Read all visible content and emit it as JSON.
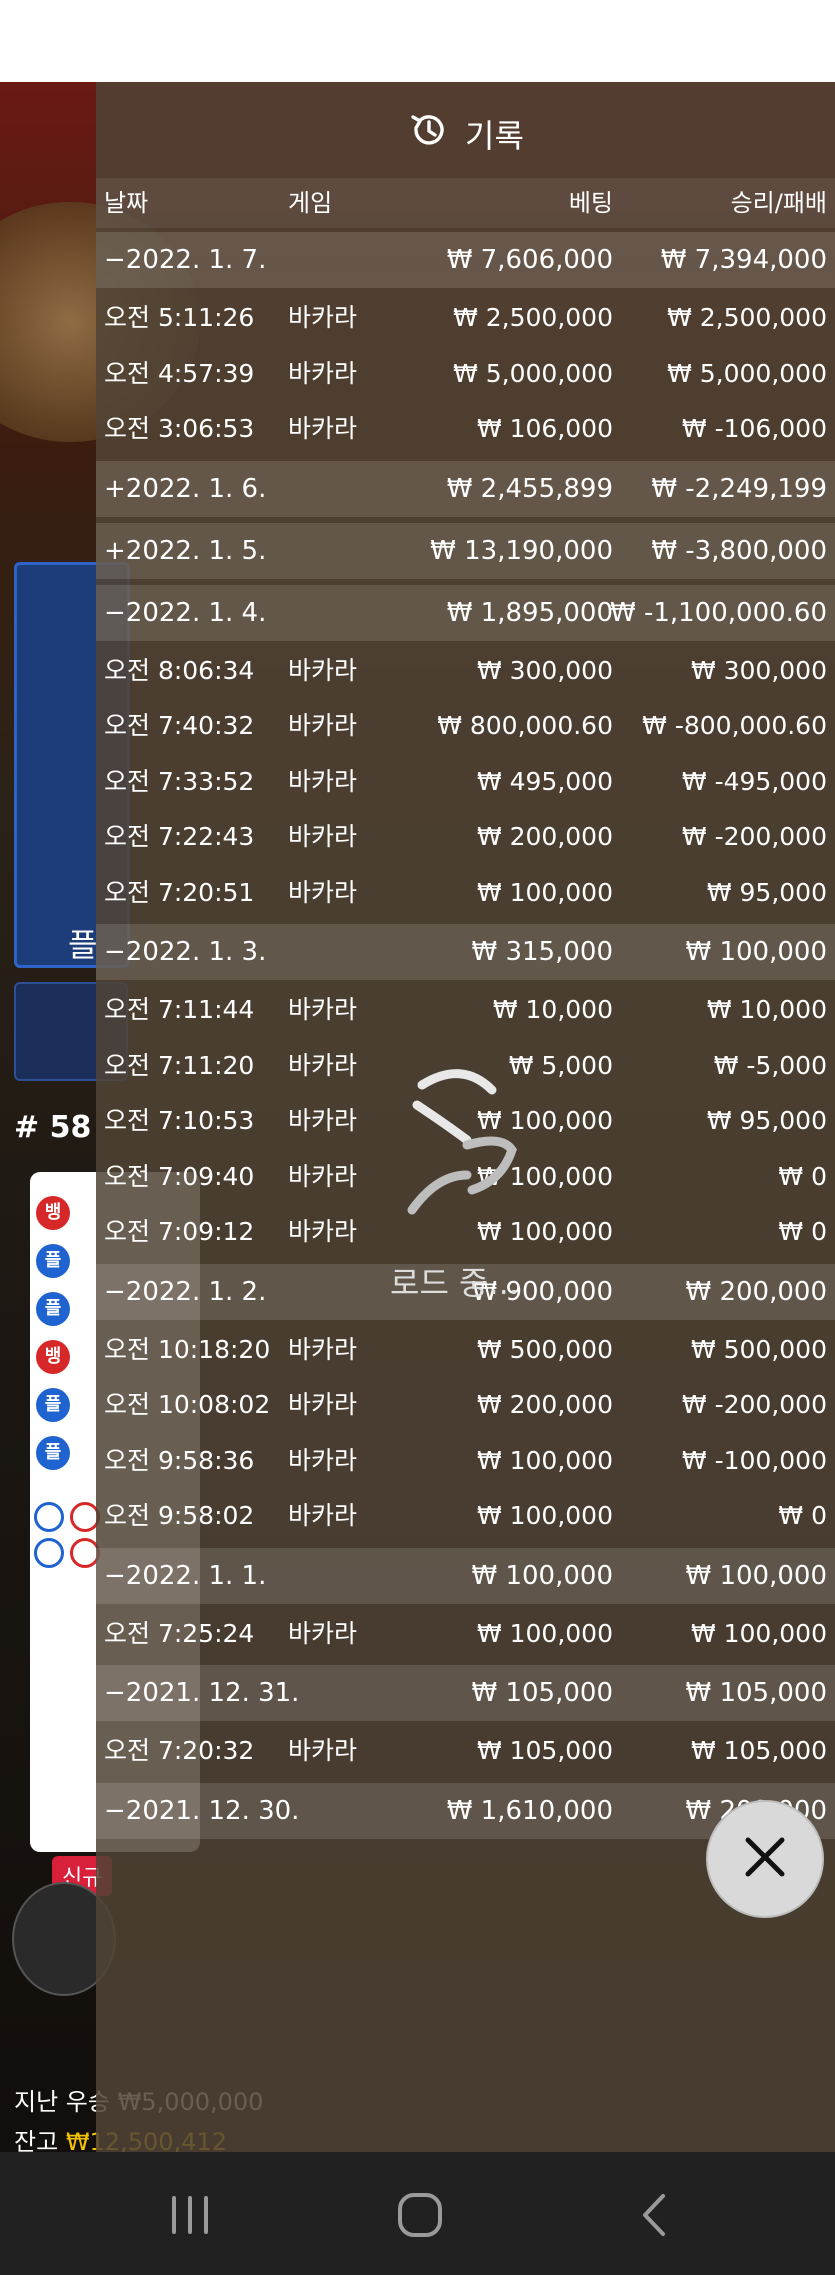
{
  "panel": {
    "title": "기록",
    "columns": {
      "date": "날짜",
      "game": "게임",
      "bet": "베팅",
      "result": "승리/패배"
    }
  },
  "rows": [
    {
      "type": "group",
      "date": "−2022. 1. 7.",
      "game": "",
      "bet": "₩ 7,606,000",
      "result": "₩ 7,394,000"
    },
    {
      "type": "item",
      "date": "오전 5:11:26",
      "game": "바카라",
      "bet": "₩ 2,500,000",
      "result": "₩ 2,500,000"
    },
    {
      "type": "item",
      "date": "오전 4:57:39",
      "game": "바카라",
      "bet": "₩ 5,000,000",
      "result": "₩ 5,000,000"
    },
    {
      "type": "item",
      "date": "오전 3:06:53",
      "game": "바카라",
      "bet": "₩ 106,000",
      "result": "₩ -106,000"
    },
    {
      "type": "group",
      "date": "+2022. 1. 6.",
      "game": "",
      "bet": "₩ 2,455,899",
      "result": "₩ -2,249,199"
    },
    {
      "type": "group",
      "date": "+2022. 1. 5.",
      "game": "",
      "bet": "₩ 13,190,000",
      "result": "₩ -3,800,000"
    },
    {
      "type": "group",
      "date": "−2022. 1. 4.",
      "game": "",
      "bet": "₩ 1,895,000",
      "result": "₩ -1,100,000.60"
    },
    {
      "type": "item",
      "date": "오전 8:06:34",
      "game": "바카라",
      "bet": "₩ 300,000",
      "result": "₩ 300,000"
    },
    {
      "type": "item",
      "date": "오전 7:40:32",
      "game": "바카라",
      "bet": "₩ 800,000.60",
      "result": "₩ -800,000.60"
    },
    {
      "type": "item",
      "date": "오전 7:33:52",
      "game": "바카라",
      "bet": "₩ 495,000",
      "result": "₩ -495,000"
    },
    {
      "type": "item",
      "date": "오전 7:22:43",
      "game": "바카라",
      "bet": "₩ 200,000",
      "result": "₩ -200,000"
    },
    {
      "type": "item",
      "date": "오전 7:20:51",
      "game": "바카라",
      "bet": "₩ 100,000",
      "result": "₩ 95,000"
    },
    {
      "type": "group",
      "date": "−2022. 1. 3.",
      "game": "",
      "bet": "₩ 315,000",
      "result": "₩ 100,000"
    },
    {
      "type": "item",
      "date": "오전 7:11:44",
      "game": "바카라",
      "bet": "₩ 10,000",
      "result": "₩ 10,000"
    },
    {
      "type": "item",
      "date": "오전 7:11:20",
      "game": "바카라",
      "bet": "₩ 5,000",
      "result": "₩ -5,000"
    },
    {
      "type": "item",
      "date": "오전 7:10:53",
      "game": "바카라",
      "bet": "₩ 100,000",
      "result": "₩ 95,000"
    },
    {
      "type": "item",
      "date": "오전 7:09:40",
      "game": "바카라",
      "bet": "₩ 100,000",
      "result": "₩ 0"
    },
    {
      "type": "item",
      "date": "오전 7:09:12",
      "game": "바카라",
      "bet": "₩ 100,000",
      "result": "₩ 0"
    },
    {
      "type": "group",
      "date": "−2022. 1. 2.",
      "game": "",
      "bet": "₩ 900,000",
      "result": "₩ 200,000"
    },
    {
      "type": "item",
      "date": "오전 10:18:20",
      "game": "바카라",
      "bet": "₩ 500,000",
      "result": "₩ 500,000"
    },
    {
      "type": "item",
      "date": "오전 10:08:02",
      "game": "바카라",
      "bet": "₩ 200,000",
      "result": "₩ -200,000"
    },
    {
      "type": "item",
      "date": "오전 9:58:36",
      "game": "바카라",
      "bet": "₩ 100,000",
      "result": "₩ -100,000"
    },
    {
      "type": "item",
      "date": "오전 9:58:02",
      "game": "바카라",
      "bet": "₩ 100,000",
      "result": "₩ 0"
    },
    {
      "type": "group",
      "date": "−2022. 1. 1.",
      "game": "",
      "bet": "₩ 100,000",
      "result": "₩ 100,000"
    },
    {
      "type": "item",
      "date": "오전 7:25:24",
      "game": "바카라",
      "bet": "₩ 100,000",
      "result": "₩ 100,000"
    },
    {
      "type": "group",
      "date": "−2021. 12. 31.",
      "game": "",
      "bet": "₩ 105,000",
      "result": "₩ 105,000"
    },
    {
      "type": "item",
      "date": "오전 7:20:32",
      "game": "바카라",
      "bet": "₩ 105,000",
      "result": "₩ 105,000"
    },
    {
      "type": "group",
      "date": "−2021. 12. 30.",
      "game": "",
      "bet": "₩ 1,610,000",
      "result": "₩ 200,000"
    }
  ],
  "loading": {
    "text": "로드 중..."
  },
  "background": {
    "button_label": "플",
    "round": "# 58",
    "new_badge": "신규",
    "last_win": "지난 우승 ₩5,000,000",
    "balance_label": "잔고",
    "balance_value": "₩12,500,412",
    "bead_labels": [
      "뱅",
      "플",
      "플",
      "뱅",
      "플",
      "플"
    ]
  },
  "icons": {
    "history": "history-icon",
    "close": "close-icon",
    "loading": "loading-spinner-icon",
    "nav_recent": "recent-apps-icon",
    "nav_home": "home-icon",
    "nav_back": "back-icon"
  },
  "colors": {
    "panel": "#50443680",
    "group_row": "#ffffff22",
    "balance": "#f2c200",
    "banker": "#d62828",
    "player": "#1e63d0"
  }
}
